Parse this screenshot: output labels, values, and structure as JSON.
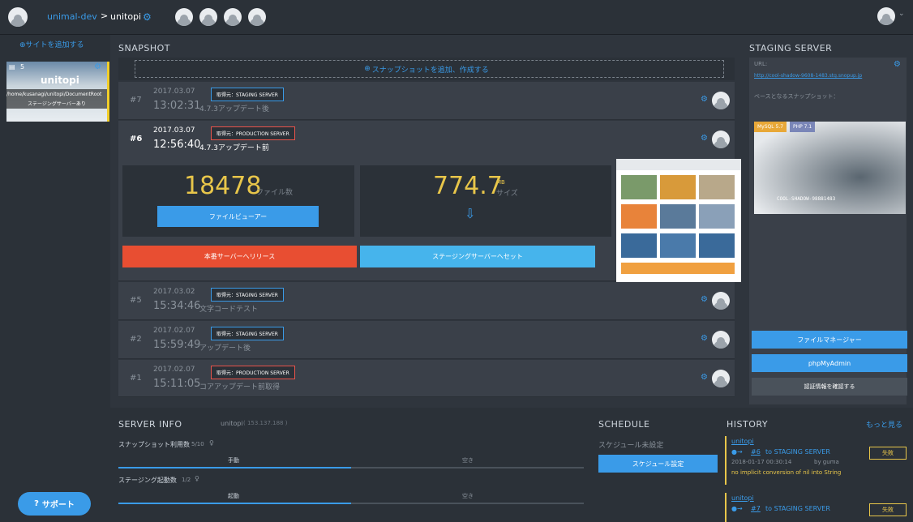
{
  "topbar": {
    "breadcrumb_org": "unimal-dev",
    "breadcrumb_sep": ">",
    "breadcrumb_site": "unitopi",
    "user_dropdown": "⌄"
  },
  "sidebar": {
    "add_site": "サイトを追加する",
    "site_card": {
      "count": "5",
      "name": "unitopi",
      "path": "/home/kusanagi/unitopi/DocumentRoot",
      "staging": "ステージングサーバーあり"
    },
    "support": "サポート"
  },
  "snapshot": {
    "title": "SNAPSHOT",
    "add_label": "スナップショットを追加、作成する",
    "rows": [
      {
        "num": "#7",
        "date": "2017.03.07",
        "time": "13:02:31",
        "desc": "4.7.3アップデート後",
        "source": "取得元：STAGING SERVER"
      },
      {
        "num": "#6",
        "date": "2017.03.07",
        "time": "12:56:40",
        "desc": "4.7.3アップデート前",
        "source": "取得元：PRODUCTION SERVER"
      },
      {
        "num": "#5",
        "date": "2017.03.02",
        "time": "15:34:46",
        "desc": "文字コードテスト",
        "source": "取得元：STAGING SERVER"
      },
      {
        "num": "#2",
        "date": "2017.02.07",
        "time": "15:59:49",
        "desc": "アップデート後",
        "source": "取得元：STAGING SERVER"
      },
      {
        "num": "#1",
        "date": "2017.02.07",
        "time": "15:11:05",
        "desc": "コアアップデート前取得",
        "source": "取得元：PRODUCTION SERVER"
      }
    ],
    "detail": {
      "files_count": "18478",
      "files_unit": "ファイル数",
      "file_viewer": "ファイルビューアー",
      "size_value": "774.7",
      "size_unit": "MB",
      "size_label": "サイズ",
      "release_btn": "本番サーバーへリリース",
      "reset_btn": "ステージングサーバーへセット"
    }
  },
  "staging": {
    "title": "STAGING SERVER",
    "url_label": "URL:",
    "url": "http://cool-shadow-9608-1483.stg.snopup.jp",
    "base_snapshot": "ベースとなるスナップショット：",
    "mysql": "MySQL 5.7",
    "php": "PHP 7.1",
    "preview_label": "COOL-SHADOW-98881483",
    "file_manager": "ファイルマネージャー",
    "phpmyadmin": "phpMyAdmin",
    "credentials": "認証情報を確認する"
  },
  "server_info": {
    "title": "SERVER INFO",
    "site": "unitopi",
    "site_extra": "( 153.137.188 )",
    "snap_usage": "スナップショット利用数",
    "snap_usage_val": "5/10",
    "snap_bar_left": "手動",
    "snap_bar_right": "空き",
    "snap_fill": 0.5,
    "stg_usage": "ステージング起動数",
    "stg_usage_val": "1/2",
    "stg_bar_left": "起動",
    "stg_bar_right": "空き",
    "stg_fill": 0.5
  },
  "schedule": {
    "title": "SCHEDULE",
    "none": "スケジュール未設定",
    "btn": "スケジュール設定"
  },
  "history": {
    "title": "HISTORY",
    "more": "もっと見る",
    "items": [
      {
        "site": "unitopi",
        "arrow": "●→",
        "snap": "#6",
        "target": "to STAGING SERVER",
        "time": "2018-01-17 00:30:14",
        "by": "by guma",
        "error": "no implicit conversion of nil into String",
        "status": "失敗"
      },
      {
        "site": "unitopi",
        "arrow": "●→",
        "snap": "#7",
        "target": "to STAGING SERVER",
        "time": "",
        "by": "",
        "error": "",
        "status": "失敗"
      }
    ]
  }
}
